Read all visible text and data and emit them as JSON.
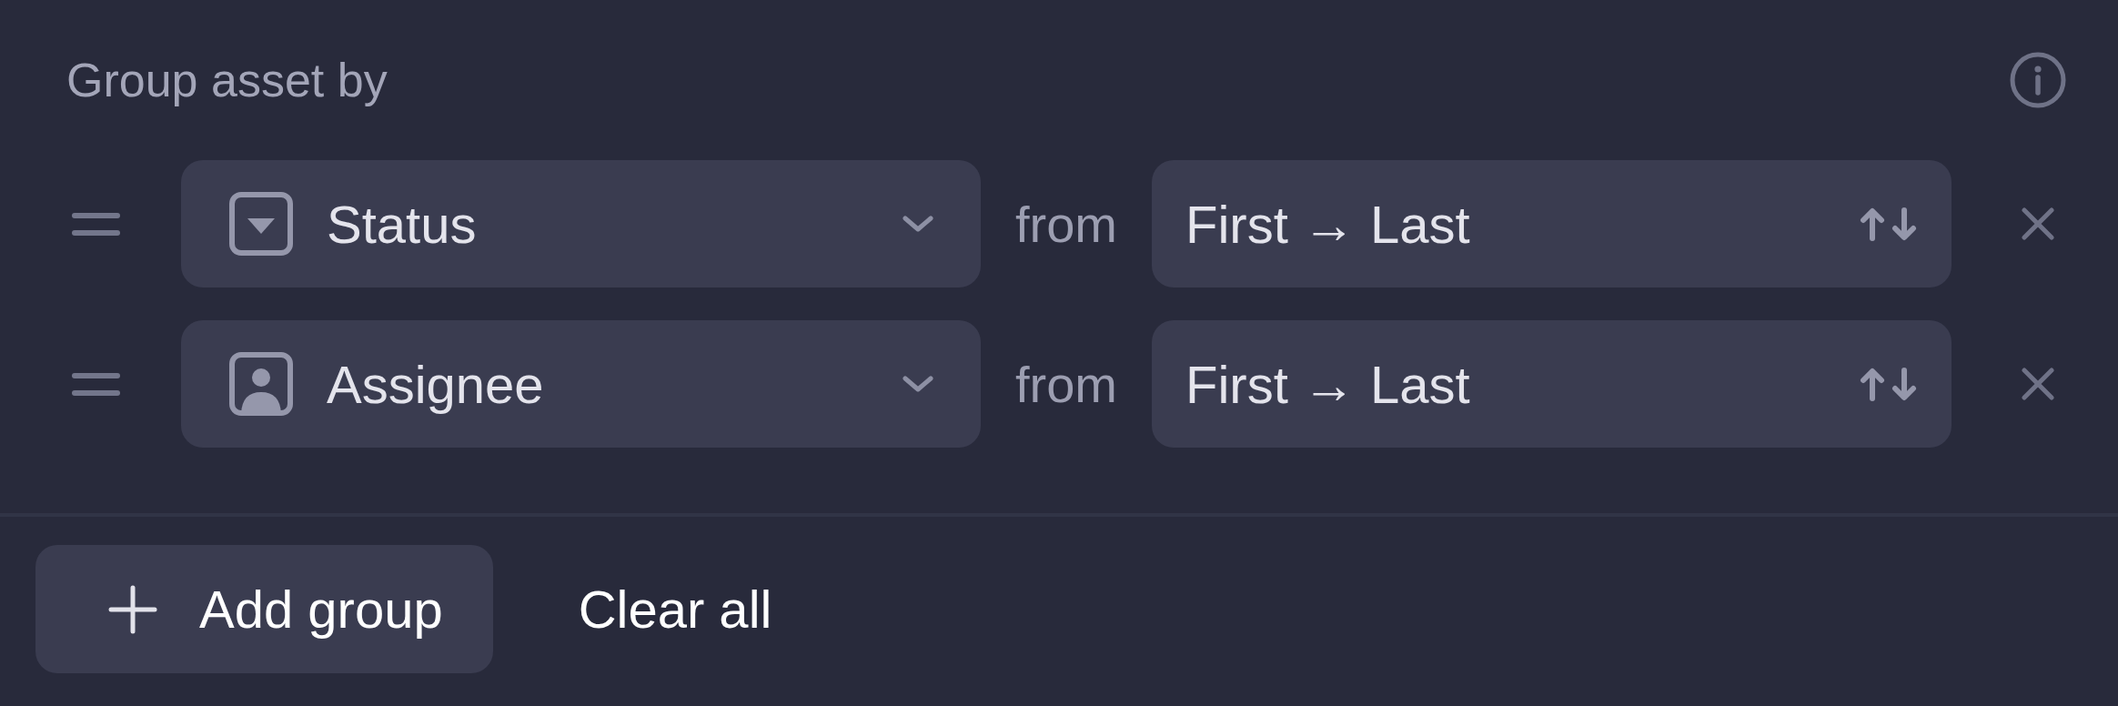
{
  "header": {
    "title": "Group asset by"
  },
  "groups": [
    {
      "field": {
        "kind": "status",
        "label": "Status"
      },
      "connector": "from",
      "order": "First → Last"
    },
    {
      "field": {
        "kind": "person",
        "label": "Assignee"
      },
      "connector": "from",
      "order": "First → Last"
    }
  ],
  "footer": {
    "add_button": "Add group",
    "clear_button": "Clear all"
  }
}
